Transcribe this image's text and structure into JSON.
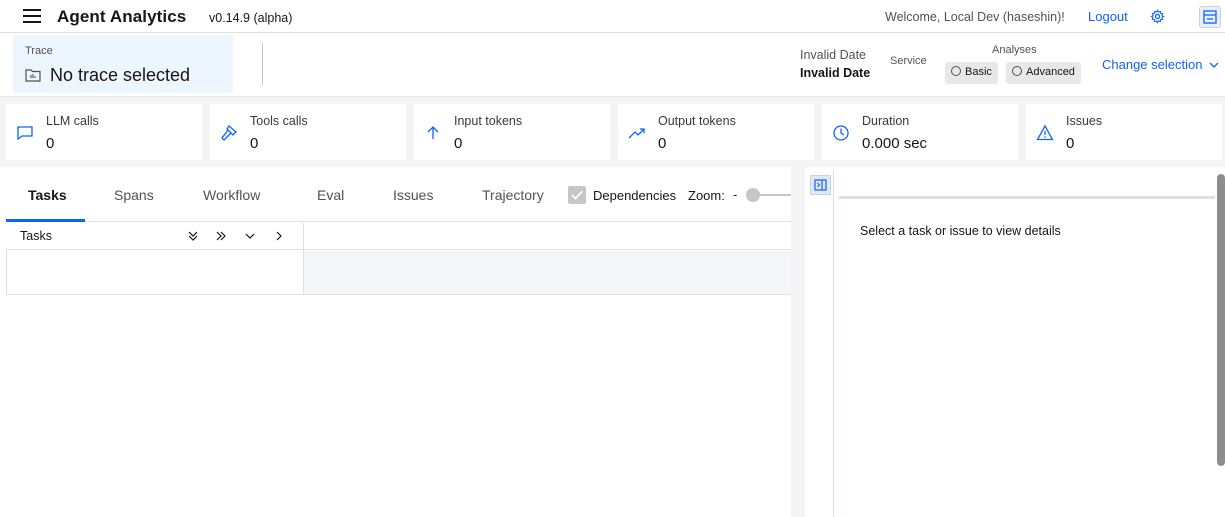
{
  "header": {
    "app_title": "Agent Analytics",
    "version": "v0.14.9 (alpha)",
    "welcome": "Welcome, Local Dev (haseshin)!",
    "logout_label": "Logout"
  },
  "trace": {
    "label": "Trace",
    "value": "No trace selected",
    "date_line1": "Invalid Date",
    "date_line2": "Invalid Date",
    "service_label": "Service",
    "analyses_label": "Analyses",
    "analyses_options": [
      "Basic",
      "Advanced"
    ],
    "change_selection": "Change selection"
  },
  "metrics": [
    {
      "label": "LLM calls",
      "value": "0",
      "icon": "chat-icon"
    },
    {
      "label": "Tools calls",
      "value": "0",
      "icon": "hammer-icon"
    },
    {
      "label": "Input tokens",
      "value": "0",
      "icon": "arrow-up-icon"
    },
    {
      "label": "Output tokens",
      "value": "0",
      "icon": "trend-up-icon"
    },
    {
      "label": "Duration",
      "value": "0.000 sec",
      "icon": "clock-icon"
    },
    {
      "label": "Issues",
      "value": "0",
      "icon": "warning-icon"
    }
  ],
  "tabs": [
    "Tasks",
    "Spans",
    "Workflow",
    "Eval",
    "Issues",
    "Trajectory"
  ],
  "active_tab": "Tasks",
  "controls": {
    "dependencies_label": "Dependencies",
    "zoom_label": "Zoom:",
    "zoom_minus": "-"
  },
  "tasks_table": {
    "header": "Tasks",
    "controls": [
      "»",
      "»",
      "⌄",
      "›"
    ]
  },
  "details": {
    "placeholder": "Select a task or issue to view details"
  },
  "colors": {
    "accent": "#0f62fe",
    "trace_bg": "#edf5ff",
    "metrics_bg": "#f4f4f4"
  }
}
